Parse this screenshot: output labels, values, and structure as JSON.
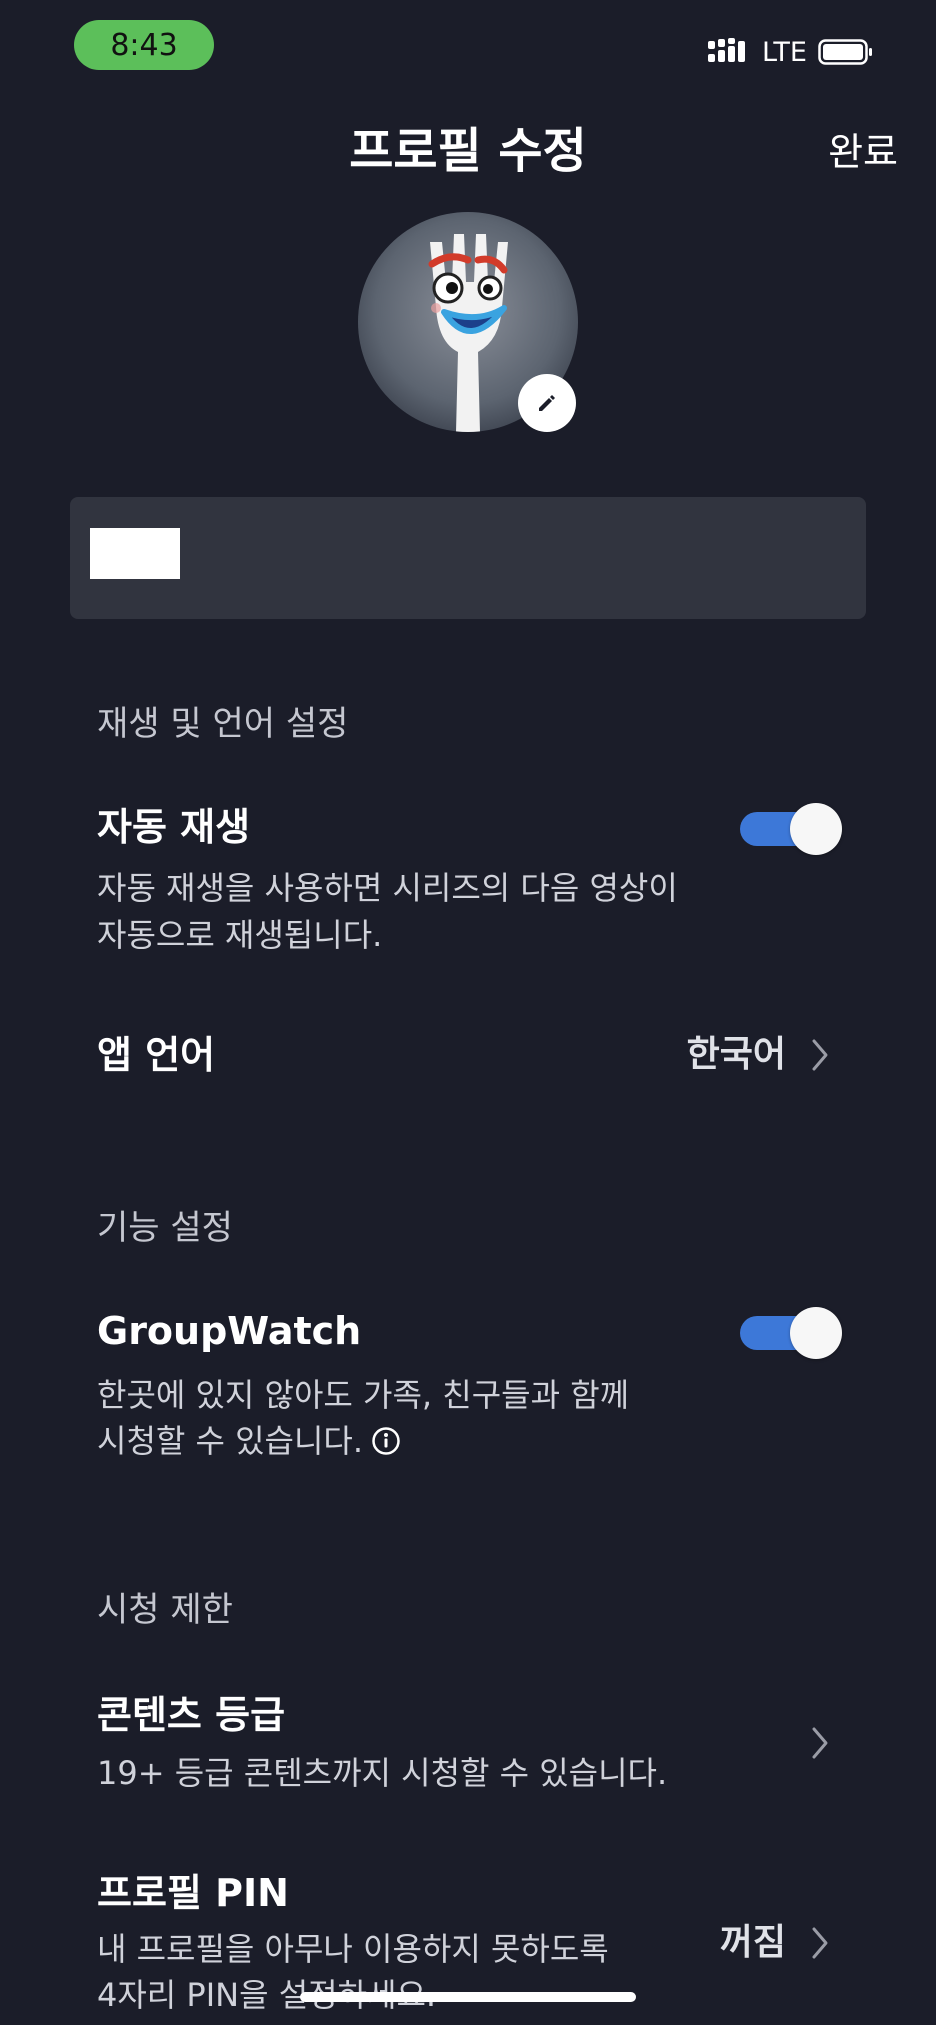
{
  "status_bar": {
    "time": "8:43",
    "network": "LTE",
    "pill_color": "#5cbf5a"
  },
  "header": {
    "title": "프로필 수정",
    "done_label": "완료"
  },
  "avatar": {
    "icon": "forky-avatar",
    "edit_icon": "pencil-icon"
  },
  "name_field": {
    "value": ""
  },
  "sections": {
    "playback": {
      "header": "재생 및 언어 설정",
      "autoplay": {
        "title": "자동 재생",
        "desc_line1": "자동 재생을 사용하면 시리즈의 다음 영상이",
        "desc_line2": "자동으로 재생됩니다.",
        "enabled": true
      },
      "app_language": {
        "title": "앱 언어",
        "value": "한국어"
      }
    },
    "features": {
      "header": "기능 설정",
      "groupwatch": {
        "title": "GroupWatch",
        "desc_line1": "한곳에 있지 않아도 가족, 친구들과 함께",
        "desc_line2": "시청할 수 있습니다.",
        "enabled": true
      }
    },
    "restrictions": {
      "header": "시청 제한",
      "content_rating": {
        "title": "콘텐츠 등급",
        "desc": "19+ 등급 콘텐츠까지 시청할 수 있습니다."
      },
      "profile_pin": {
        "title": "프로필 PIN",
        "desc_line1": "내 프로필을 아무나 이용하지 못하도록",
        "desc_line2": "4자리 PIN을 설정하세요.",
        "value": "꺼짐"
      }
    }
  },
  "colors": {
    "background": "#1b1d29",
    "field": "#31343f",
    "toggle_on": "#3d78d8"
  }
}
